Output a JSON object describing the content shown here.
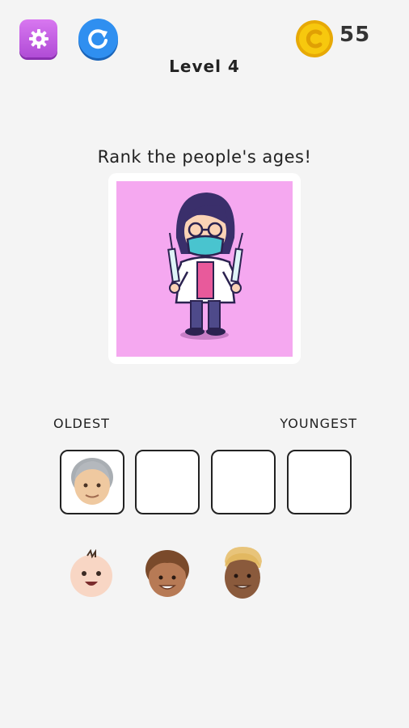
{
  "header": {
    "level_title": "Level 4",
    "coins": "55",
    "settings_icon": "gear-icon",
    "restart_icon": "restart-icon",
    "coin_icon": "coin-icon"
  },
  "prompt": "Rank the people's ages!",
  "picture": {
    "subject": "doctor-with-syringes",
    "background": "#f5a8f0"
  },
  "ranking": {
    "oldest_label": "OLDEST",
    "youngest_label": "YOUNGEST",
    "slots": [
      "elderly-face",
      "",
      "",
      ""
    ]
  },
  "choices": [
    "baby-face",
    "child-face",
    "adult-face"
  ],
  "colors": {
    "settings": "#c55ee6",
    "restart": "#2f8ff0",
    "coin": "#f7c80e"
  }
}
